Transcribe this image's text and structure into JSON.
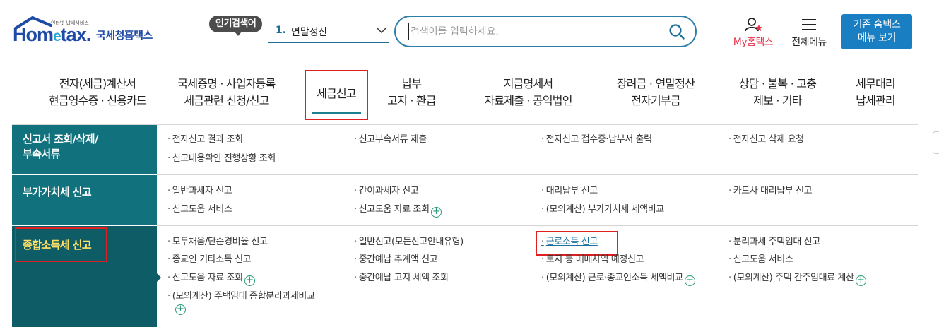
{
  "header": {
    "logo": {
      "small": "인터넷 납세서비스",
      "brand": "Hometax.",
      "org": "국세청홈택스"
    },
    "popular": {
      "label": "인기검색어",
      "rank": "1.",
      "keyword": "연말정산"
    },
    "search": {
      "placeholder": "검색어를 입력하세요."
    },
    "my_label": "My홈택스",
    "all_menu_label": "전체메뉴",
    "old_menu": {
      "line1": "기존 홈택스",
      "line2": "메뉴 보기"
    }
  },
  "nav": {
    "items": [
      {
        "line1": "전자(세금)계산서",
        "line2": "현금영수증 · 신용카드"
      },
      {
        "line1": "국세증명 · 사업자등록",
        "line2": "세금관련 신청/신고"
      },
      {
        "line1": "세금신고",
        "line2": ""
      },
      {
        "line1": "납부",
        "line2": "고지 · 환급"
      },
      {
        "line1": "지급명세서",
        "line2": "자료제출 · 공익법인"
      },
      {
        "line1": "장려금 · 연말정산",
        "line2": "전자기부금"
      },
      {
        "line1": "상담 · 불복 · 고충",
        "line2": "제보 · 기타"
      },
      {
        "line1": "세무대리",
        "line2": "납세관리"
      }
    ],
    "active_index": 2
  },
  "menu": {
    "categories": [
      {
        "line1": "신고서 조회/삭제/",
        "line2": "부속서류"
      },
      {
        "line1": "부가가치세 신고",
        "line2": ""
      },
      {
        "line1": "종합소득세 신고",
        "line2": ""
      }
    ],
    "links": {
      "r0": [
        "전자신고 결과 조회",
        "신고부속서류 제출",
        "전자신고 접수증·납부서 출력",
        "전자신고 삭제 요청",
        "신고내용확인 진행상황 조회"
      ],
      "r1": [
        "일반과세자 신고",
        "간이과세자 신고",
        "대리납부 신고",
        "카드사 대리납부 신고",
        "신고도움 서비스",
        "신고도움 자료 조회",
        "(모의계산) 부가가치세 세액비교"
      ],
      "r2": [
        "모두채움/단순경비율 신고",
        "일반신고(모든신고안내유형)",
        "근로소득 신고",
        "분리과세 주택임대 신고",
        "종교인 기타소득 신고",
        "중간예납 추계액 신고",
        "토지 등 매매차익 예정신고",
        "신고도움 서비스",
        "신고도움 자료 조회",
        "중간예납 고지 세액 조회",
        "(모의계산) 근로·종교인소득 세액비교",
        "(모의계산) 주택 간주임대료 계산",
        "(모의계산) 주택임대 종합분리과세비교"
      ]
    }
  },
  "colors": {
    "teal": "#11727e",
    "teal_dark": "#0d5c66",
    "highlight_red": "#e02020",
    "brand_blue": "#1f4aa6",
    "button_blue": "#1a7ec2"
  }
}
